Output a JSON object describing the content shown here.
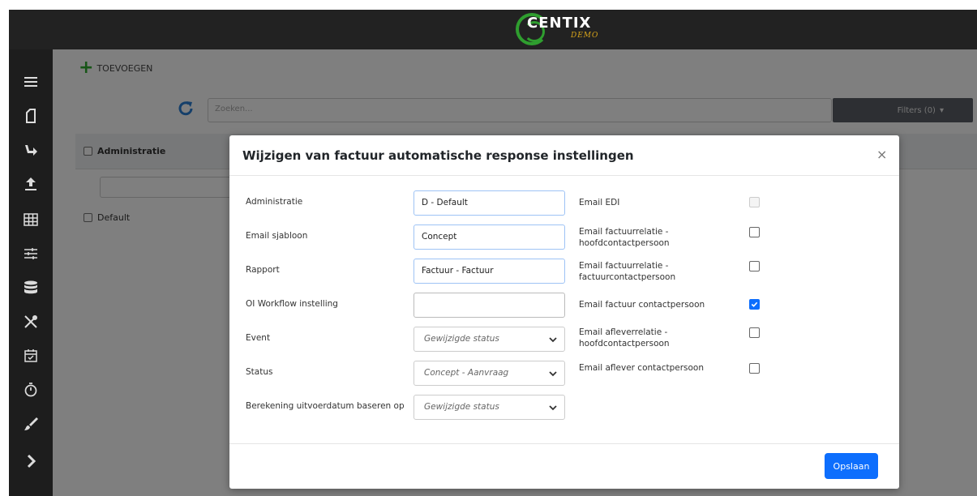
{
  "app": {
    "logo_text": "CENTIX",
    "logo_sub": "DEMO"
  },
  "sidebar": {
    "items": [
      {
        "icon": "hamburger-icon"
      },
      {
        "icon": "document-icon"
      },
      {
        "icon": "share-arrow-icon"
      },
      {
        "icon": "upload-icon"
      },
      {
        "icon": "table-icon"
      },
      {
        "icon": "sliders-icon"
      },
      {
        "icon": "database-icon"
      },
      {
        "icon": "tools-icon"
      },
      {
        "icon": "calendar-check-icon"
      },
      {
        "icon": "stopwatch-icon"
      },
      {
        "icon": "brush-icon"
      },
      {
        "icon": "chevron-right-icon"
      }
    ]
  },
  "main": {
    "add_label": "TOEVOEGEN",
    "search_placeholder": "Zoeken...",
    "filters_label": "Filters (0)",
    "grid_header": "Administratie",
    "grid_row": "Default"
  },
  "modal": {
    "title": "Wijzigen van factuur automatische response instellingen",
    "close": "×",
    "save_label": "Opslaan",
    "fields": {
      "administratie": {
        "label": "Administratie",
        "value": "D - Default"
      },
      "email_sjabloon": {
        "label": "Email sjabloon",
        "value": "Concept"
      },
      "rapport": {
        "label": "Rapport",
        "value": "Factuur - Factuur"
      },
      "oi_workflow": {
        "label": "OI Workflow instelling",
        "value": ""
      },
      "event": {
        "label": "Event",
        "value": "Gewijzigde status"
      },
      "status": {
        "label": "Status",
        "value": "Concept - Aanvraag"
      },
      "berekening": {
        "label": "Berekening uitvoerdatum baseren op",
        "value": "Gewijzigde status"
      }
    },
    "checks": {
      "email_edi": {
        "label": "Email EDI",
        "checked": false,
        "disabled": true
      },
      "factuurrelatie_hoofd": {
        "label": "Email factuurrelatie - hoofdcontactpersoon",
        "checked": false
      },
      "factuurrelatie_factuur": {
        "label": "Email factuurrelatie - factuurcontactpersoon",
        "checked": false
      },
      "factuur_contact": {
        "label": "Email factuur contactpersoon",
        "checked": true
      },
      "afleverrelatie_hoofd": {
        "label": "Email afleverrelatie - hoofdcontactpersoon",
        "checked": false
      },
      "aflever_contact": {
        "label": "Email aflever contactpersoon",
        "checked": false
      }
    }
  },
  "colors": {
    "primary": "#0d6efd",
    "topbar": "#222222",
    "sidebar": "#1d1d1d",
    "accent_green": "#2eaa2e"
  }
}
